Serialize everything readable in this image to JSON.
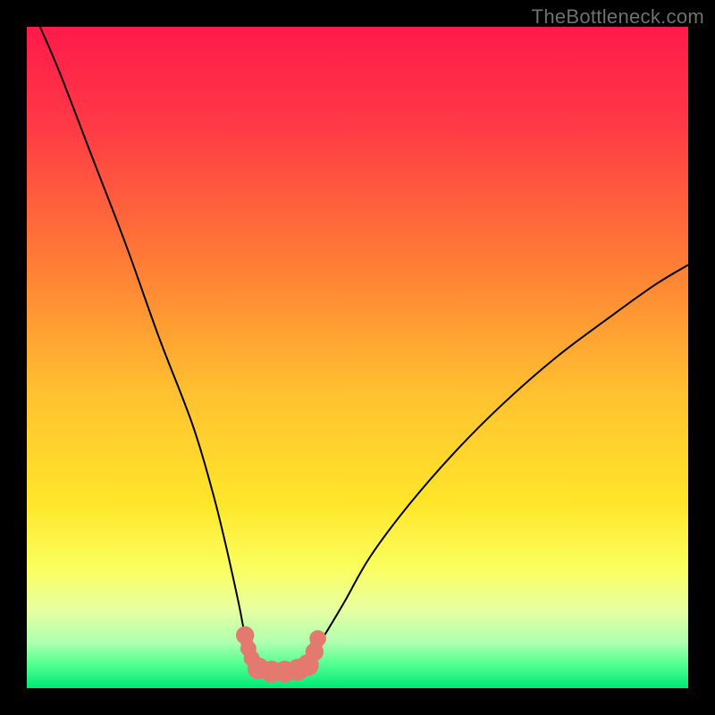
{
  "watermark": "TheBottleneck.com",
  "chart_data": {
    "type": "line",
    "title": "",
    "xlabel": "",
    "ylabel": "",
    "xlim": [
      0,
      100
    ],
    "ylim": [
      0,
      100
    ],
    "series": [
      {
        "name": "curve-left",
        "description": "steep descending curve from top-left into the valley",
        "x": [
          2,
          5,
          10,
          15,
          20,
          25,
          28,
          30,
          32,
          33,
          34,
          35
        ],
        "y": [
          100,
          93,
          80,
          67,
          53,
          40,
          30,
          22,
          13,
          8,
          5,
          3
        ]
      },
      {
        "name": "curve-right",
        "description": "rising curve from valley to middle-right edge",
        "x": [
          42,
          43,
          45,
          48,
          52,
          58,
          65,
          72,
          80,
          88,
          95,
          100
        ],
        "y": [
          3,
          5,
          8,
          13,
          20,
          28,
          36,
          43,
          50,
          56,
          61,
          64
        ]
      },
      {
        "name": "valley-floor",
        "description": "flat bottom connecting the two curves",
        "x": [
          35,
          38,
          40,
          42
        ],
        "y": [
          3,
          2.5,
          2.5,
          3
        ]
      }
    ],
    "markers": {
      "name": "valley-beads",
      "description": "coral-colored beads clustered at the valley bottom",
      "points": [
        {
          "x": 33,
          "y": 8,
          "r": 2.5
        },
        {
          "x": 33.5,
          "y": 6,
          "r": 2.2
        },
        {
          "x": 34,
          "y": 4.5,
          "r": 2.2
        },
        {
          "x": 35,
          "y": 3,
          "r": 3
        },
        {
          "x": 37,
          "y": 2.5,
          "r": 3
        },
        {
          "x": 39,
          "y": 2.5,
          "r": 3
        },
        {
          "x": 41,
          "y": 2.8,
          "r": 3
        },
        {
          "x": 42.5,
          "y": 3.5,
          "r": 3
        },
        {
          "x": 43.5,
          "y": 5.5,
          "r": 2.5
        },
        {
          "x": 44,
          "y": 7.5,
          "r": 2.3
        }
      ],
      "color": "#e47a6f"
    },
    "background": {
      "type": "vertical-gradient",
      "stops": [
        {
          "offset": 0,
          "color": "#ff1a4a"
        },
        {
          "offset": 0.15,
          "color": "#ff3a46"
        },
        {
          "offset": 0.35,
          "color": "#ff7a36"
        },
        {
          "offset": 0.55,
          "color": "#ffc030"
        },
        {
          "offset": 0.72,
          "color": "#ffe62a"
        },
        {
          "offset": 0.82,
          "color": "#faff60"
        },
        {
          "offset": 0.88,
          "color": "#e8ffa0"
        },
        {
          "offset": 0.93,
          "color": "#b0ffb0"
        },
        {
          "offset": 0.965,
          "color": "#50ff90"
        },
        {
          "offset": 1.0,
          "color": "#00e878"
        }
      ]
    }
  }
}
